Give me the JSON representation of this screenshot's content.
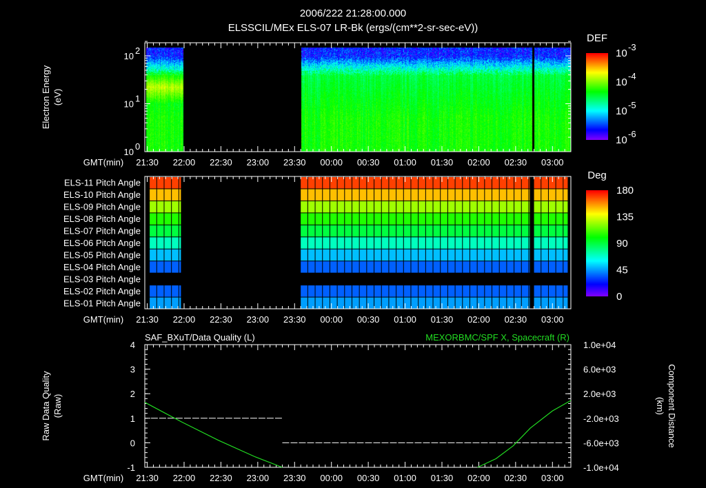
{
  "title": {
    "line1": "2006/222 21:28:00.000",
    "line2": "ELSSCIL/MEx ELS-07 LR-Bk  (ergs/(cm**2-sr-sec-eV))"
  },
  "time_axis": {
    "label": "GMT(min)",
    "start": "21:28",
    "end": "03:15",
    "ticks": [
      "21:30",
      "22:00",
      "22:30",
      "23:00",
      "23:30",
      "00:00",
      "00:30",
      "01:00",
      "01:30",
      "02:00",
      "02:30",
      "03:00"
    ]
  },
  "chart_data": [
    {
      "type": "heatmap",
      "name": "electron-spectrogram",
      "ylabel": "Electron Energy",
      "yunit": "(eV)",
      "yscale": "log",
      "ylim_eV": [
        1,
        200
      ],
      "data_top_eV": 150,
      "ytick_labels": [
        {
          "base": "10",
          "exp": "0",
          "value": 1
        },
        {
          "base": "10",
          "exp": "1",
          "value": 10
        },
        {
          "base": "10",
          "exp": "2",
          "value": 100
        }
      ],
      "colorbar": {
        "title": "DEF",
        "range_log10": [
          -6,
          -3
        ],
        "labels": [
          {
            "base": "10",
            "exp": "-3"
          },
          {
            "base": "10",
            "exp": "-4"
          },
          {
            "base": "10",
            "exp": "-5"
          },
          {
            "base": "10",
            "exp": "-6"
          }
        ]
      },
      "data_segments": [
        [
          "21:29",
          "21:59"
        ],
        [
          "23:35",
          "02:43"
        ],
        [
          "02:45",
          "03:15"
        ]
      ],
      "typical_log10_DEF": {
        "low_energy_1_5eV": -4.3,
        "mid_10_30eV": -4.5,
        "high_50_150eV": -5.6,
        "first_segment_20eV": -3.9
      }
    },
    {
      "type": "heatmap",
      "name": "pitch-angle-panel",
      "rows": [
        {
          "label": "ELS-11 Pitch Angle",
          "deg": 170
        },
        {
          "label": "ELS-10 Pitch Angle",
          "deg": 150
        },
        {
          "label": "ELS-09 Pitch Angle",
          "deg": 125
        },
        {
          "label": "ELS-08 Pitch Angle",
          "deg": 105
        },
        {
          "label": "ELS-07 Pitch Angle",
          "deg": 90
        },
        {
          "label": "ELS-06 Pitch Angle",
          "deg": 70
        },
        {
          "label": "ELS-05 Pitch Angle",
          "deg": 50
        },
        {
          "label": "ELS-04 Pitch Angle",
          "deg": 35
        },
        {
          "label": "ELS-03 Pitch Angle",
          "deg": null
        },
        {
          "label": "ELS-02 Pitch Angle",
          "deg": 35
        },
        {
          "label": "ELS-01 Pitch Angle",
          "deg": 45
        }
      ],
      "data_segments": [
        [
          "21:32",
          "21:58"
        ],
        [
          "23:35",
          "02:42"
        ],
        [
          "02:45",
          "03:13"
        ]
      ],
      "cell_minutes": 6,
      "colorbar": {
        "title": "Deg",
        "range": [
          0,
          180
        ],
        "labels": [
          "180",
          "135",
          "90",
          "45",
          "0"
        ]
      }
    },
    {
      "type": "line",
      "name": "quality-and-position",
      "left_title": "SAF_BXuT/Data Quality (L)",
      "right_title": "MEXORBMC/SPF X, Spacecraft (R)",
      "ylabel_left": "Raw Data Quality",
      "yunit_left": "(Raw)",
      "ylabel_right": "Component Distance",
      "yunit_right": "(km)",
      "ylim_left": [
        -1,
        4
      ],
      "ylim_right": [
        -10000,
        10000
      ],
      "left_ticks": [
        "4",
        "3",
        "2",
        "1",
        "0",
        "-1"
      ],
      "right_ticks": [
        "1.0e+04",
        "6.0e+03",
        "2.0e+03",
        "-2.0e+03",
        "-6.0e+03",
        "-1.0e+04"
      ],
      "series": [
        {
          "name": "Data Quality",
          "axis": "left",
          "color": "#ffffff",
          "style": "dashed",
          "segments": [
            {
              "from": "21:33",
              "to": "23:20",
              "value": 1
            },
            {
              "from": "23:20",
              "to": "03:08",
              "value": 0
            }
          ]
        },
        {
          "name": "SPF X",
          "axis": "right",
          "color": "#22dd22",
          "points": [
            [
              "21:28",
              600
            ],
            [
              "21:58",
              -2600
            ],
            [
              "22:28",
              -5600
            ],
            [
              "22:58",
              -8300
            ],
            [
              "23:20",
              -10000
            ],
            [
              "01:59",
              -10000
            ],
            [
              "02:14",
              -8600
            ],
            [
              "02:28",
              -6500
            ],
            [
              "02:42",
              -3600
            ],
            [
              "03:00",
              -800
            ],
            [
              "03:15",
              900
            ]
          ]
        }
      ]
    }
  ],
  "colors": {
    "background": "#000000",
    "axis": "#ffffff",
    "position_series": "#22dd22"
  }
}
